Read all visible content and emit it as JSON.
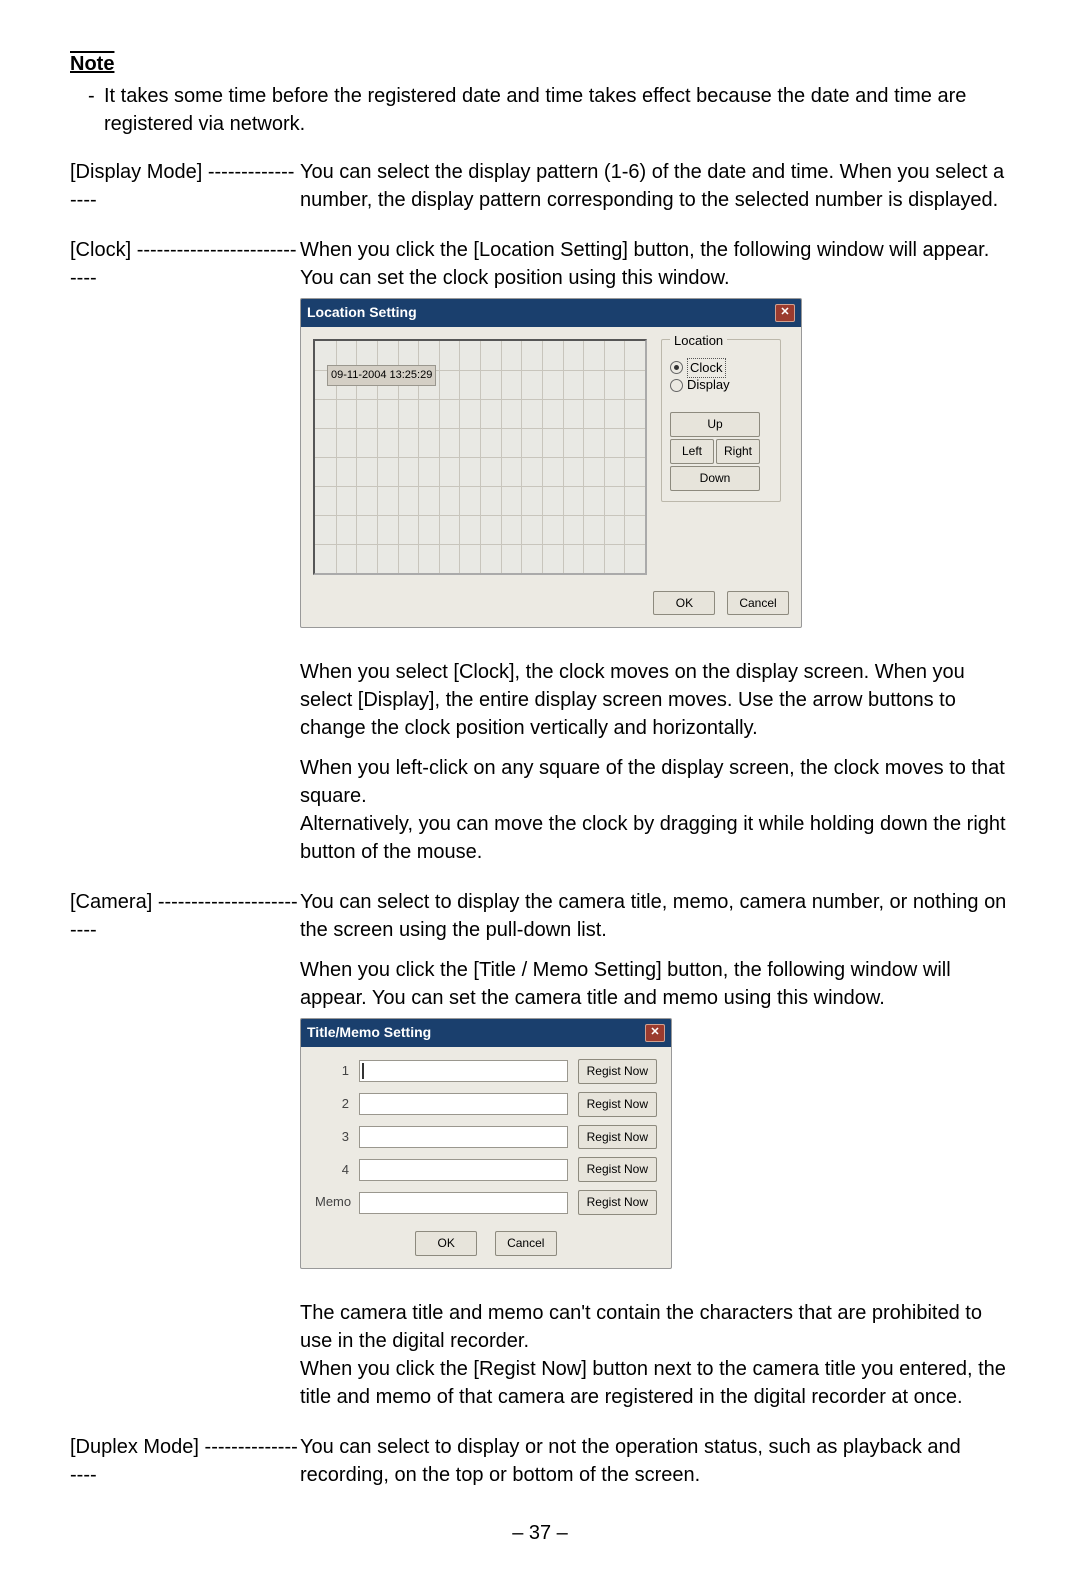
{
  "note": {
    "label": "Note",
    "dash": "-",
    "text": "It takes some time before the registered date and time takes effect because the date and time are registered via network."
  },
  "display_mode": {
    "label": "[Display Mode]",
    "dashes": "-----------------",
    "text": "You can select the display pattern (1-6) of the date and time. When you select a number, the display pattern corresponding to the selected number is displayed."
  },
  "clock": {
    "label": "[Clock]",
    "dashes": "----------------------------",
    "text1": "When you click the [Location Setting] button, the following window will appear. You can set the clock position using this window.",
    "text2": "When you select [Clock], the clock moves on the display screen. When you select [Display], the entire display screen moves. Use the arrow buttons to change the clock position vertically and horizontally.",
    "text3": "When you left-click on any square of the display screen, the clock moves to that square.",
    "text4": "Alternatively, you can move the clock by dragging it while holding down the right button of the mouse."
  },
  "loc_dialog": {
    "title": "Location Setting",
    "clock_value": "09-11-2004 13:25:29",
    "legend": "Location",
    "radio_clock": "Clock",
    "radio_display": "Display",
    "btn_up": "Up",
    "btn_left": "Left",
    "btn_right": "Right",
    "btn_down": "Down",
    "btn_ok": "OK",
    "btn_cancel": "Cancel"
  },
  "camera": {
    "label": "[Camera]",
    "dashes": "-------------------------",
    "text1": "You can select to display the camera title, memo, camera number, or nothing on the screen using the pull-down list.",
    "text2": "When you click the [Title / Memo Setting] button, the following window will appear. You can set the camera title and memo using this window.",
    "text3": "The camera title and memo can't contain the characters that are prohibited to use in the digital recorder.",
    "text4": "When you click the [Regist Now] button next to the camera title you entered, the title and memo of that camera are registered in the digital recorder at once."
  },
  "tm_dialog": {
    "title": "Title/Memo Setting",
    "rows": [
      "1",
      "2",
      "3",
      "4"
    ],
    "memo_label": "Memo",
    "regist": "Regist Now",
    "btn_ok": "OK",
    "btn_cancel": "Cancel"
  },
  "duplex": {
    "label": "[Duplex Mode]",
    "dashes": "------------------",
    "text": "You can select to display or not the operation status, such as playback and recording, on the top or bottom of the screen."
  },
  "page_num": "– 37 –"
}
